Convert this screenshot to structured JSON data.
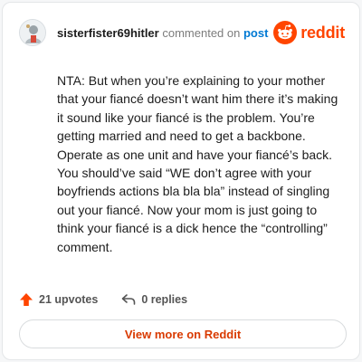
{
  "comment": {
    "author": "sisterfister69hitler",
    "action_text": "commented on",
    "target_link": "post",
    "body": "NTA: But when you’re explaining to your mother that your fiancé doesn’t want him there it’s making it sound like your fiancé is the problem. You’re getting married and need to get a backbone. Operate as one unit and have your fiancé’s back. You should’ve said “WE don’t agree with your boyfriends actions bla bla bla” instead of singling out your fiancé. Now your mom is just going to think your fiancé is a dick hence the “controlling” comment.",
    "upvotes_label": "21 upvotes",
    "replies_label": "0 replies"
  },
  "brand": {
    "name": "reddit",
    "icon": "reddit-snoo-icon",
    "color": "#ff4500"
  },
  "footer": {
    "view_more_label": "View more on Reddit"
  },
  "icons": {
    "upvote": "upvote-arrow-icon",
    "reply": "reply-arrow-icon",
    "avatar": "avatar"
  },
  "colors": {
    "accent": "#ff4500",
    "link": "#0079d3",
    "button_text": "#d93a00"
  }
}
